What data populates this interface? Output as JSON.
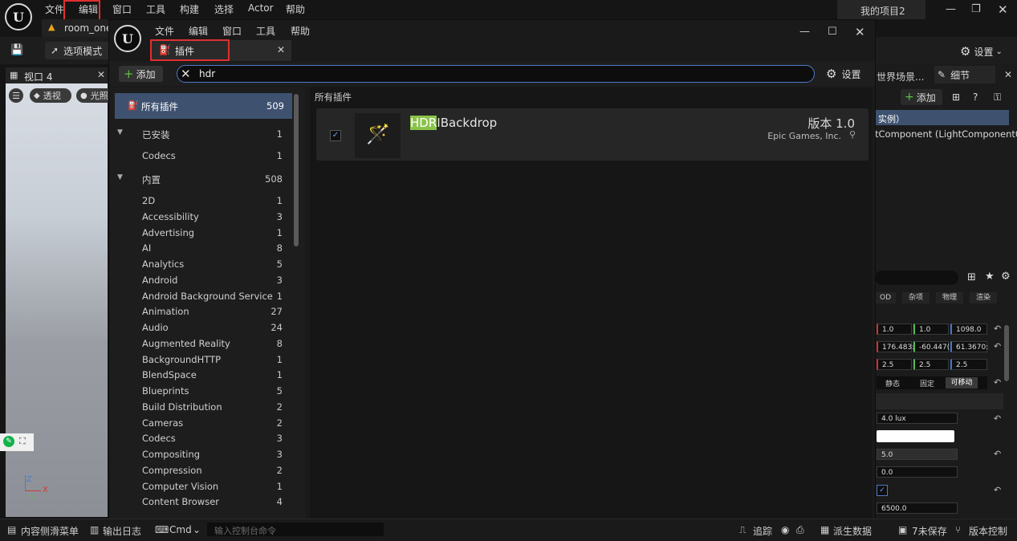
{
  "main_menu": [
    "文件",
    "编辑",
    "窗口",
    "工具",
    "构建",
    "选择",
    "Actor",
    "帮助"
  ],
  "project_name": "我的项目2",
  "level_tab": "room_one",
  "toolbar": {
    "mode_label": "选项模式",
    "settings_label": "设置"
  },
  "viewport": {
    "tab": "视口 4",
    "perspective_label": "透视",
    "lit_label": "光照",
    "axis_z": "Z",
    "axis_x": "X",
    "axis_y": "Y"
  },
  "right_panel": {
    "outliner_tab": "世界场景...",
    "details_tab": "细节",
    "add_label": "添加",
    "instance_label": "实例）",
    "component_label": "tComponent (LightComponent0)",
    "filter_tabs": [
      "OD",
      "杂项",
      "物理",
      "渲染"
    ],
    "location": [
      "1.0",
      "1.0",
      "1098.0"
    ],
    "rotation": [
      "176.483:",
      "-60.447(",
      "61.3670:"
    ],
    "scale": [
      "2.5",
      "2.5",
      "2.5"
    ],
    "mobility": [
      "静态",
      "固定",
      "可移动"
    ],
    "intensity": "4.0 lux",
    "attenuation": "5.0",
    "field_zero": "0.0",
    "temperature": "6500.0"
  },
  "plugin_window": {
    "menu": [
      "文件",
      "编辑",
      "窗口",
      "工具",
      "帮助"
    ],
    "tab_label": "插件",
    "add_label": "添加",
    "search_value": "hdr",
    "settings_label": "设置",
    "content_header": "所有插件",
    "categories": [
      {
        "label": "所有插件",
        "count": "509"
      },
      {
        "label": "已安装",
        "count": "1"
      },
      {
        "label": "Codecs",
        "count": "1"
      },
      {
        "label": "内置",
        "count": "508"
      },
      {
        "label": "2D",
        "count": "1"
      },
      {
        "label": "Accessibility",
        "count": "3"
      },
      {
        "label": "Advertising",
        "count": "1"
      },
      {
        "label": "AI",
        "count": "8"
      },
      {
        "label": "Analytics",
        "count": "5"
      },
      {
        "label": "Android",
        "count": "3"
      },
      {
        "label": "Android Background Service",
        "count": "1"
      },
      {
        "label": "Animation",
        "count": "27"
      },
      {
        "label": "Audio",
        "count": "24"
      },
      {
        "label": "Augmented Reality",
        "count": "8"
      },
      {
        "label": "BackgroundHTTP",
        "count": "1"
      },
      {
        "label": "BlendSpace",
        "count": "1"
      },
      {
        "label": "Blueprints",
        "count": "5"
      },
      {
        "label": "Build Distribution",
        "count": "2"
      },
      {
        "label": "Cameras",
        "count": "2"
      },
      {
        "label": "Codecs",
        "count": "3"
      },
      {
        "label": "Compositing",
        "count": "3"
      },
      {
        "label": "Compression",
        "count": "2"
      },
      {
        "label": "Computer Vision",
        "count": "1"
      },
      {
        "label": "Content Browser",
        "count": "4"
      }
    ],
    "plugin": {
      "name_highlight": "HDR",
      "name_rest": "IBackdrop",
      "version": "版本 1.0",
      "vendor": "Epic Games, Inc.",
      "enabled": true
    }
  },
  "statusbar": {
    "content_drawer": "内容侧滑菜单",
    "output_log": "输出日志",
    "cmd_label": "Cmd",
    "console_placeholder": "输入控制台命令",
    "trace": "追踪",
    "derived_data": "派生数据",
    "unsaved": "7未保存",
    "source_control": "版本控制"
  },
  "colors": {
    "accent_blue": "#4f78c8",
    "highlight_green": "#8bc34a",
    "selection_bg": "#3e5270",
    "red_box": "#e0302f"
  }
}
